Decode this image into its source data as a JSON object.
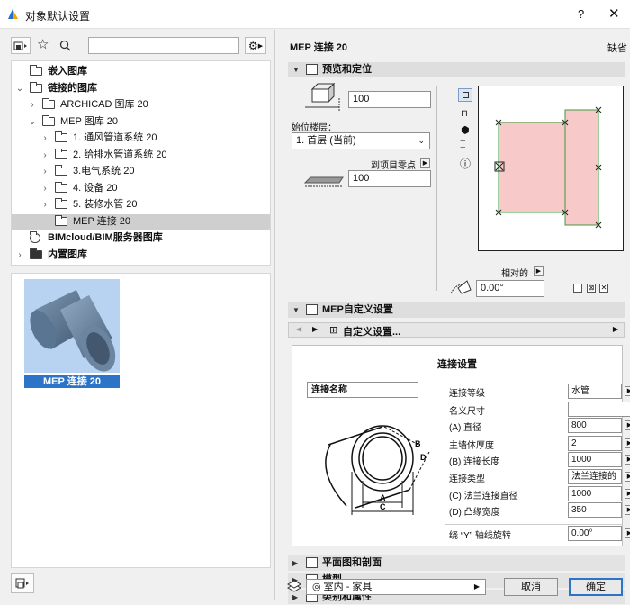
{
  "window": {
    "title": "对象默认设置",
    "help": "?",
    "close": "✕"
  },
  "left": {
    "search": {
      "value": "",
      "placeholder": ""
    },
    "tree": [
      {
        "label": "嵌入图库",
        "arrow": "",
        "bold": true,
        "icon": "library"
      },
      {
        "label": "链接的图库",
        "arrow": "v",
        "bold": true,
        "icon": "library"
      },
      {
        "label": "ARCHICAD 图库 20",
        "arrow": ">",
        "bold": false,
        "icon": "folder"
      },
      {
        "label": "MEP 图库 20",
        "arrow": "v",
        "bold": false,
        "icon": "folder"
      },
      {
        "label": "1. 通风管道系统 20",
        "arrow": ">",
        "bold": false,
        "icon": "folder"
      },
      {
        "label": "2. 给排水管道系统 20",
        "arrow": ">",
        "bold": false,
        "icon": "folder"
      },
      {
        "label": "3.电气系统 20",
        "arrow": ">",
        "bold": false,
        "icon": "folder"
      },
      {
        "label": "4. 设备 20",
        "arrow": ">",
        "bold": false,
        "icon": "folder"
      },
      {
        "label": "5. 装修水管 20",
        "arrow": ">",
        "bold": false,
        "icon": "folder"
      },
      {
        "label": "MEP 连接 20",
        "arrow": "",
        "bold": false,
        "icon": "folder"
      },
      {
        "label": "BIMcloud/BIM服务器图库",
        "arrow": "",
        "bold": true,
        "icon": "cloud"
      },
      {
        "label": "内置图库",
        "arrow": ">",
        "bold": true,
        "icon": "folder-dark"
      }
    ],
    "selected_object": "MEP 连接 20"
  },
  "right": {
    "object_name": "MEP 连接 20",
    "default_label": "缺省",
    "sections": {
      "preview": "预览和定位",
      "custom": "MEP自定义设置",
      "floorplan": "平面图和剖面",
      "model": "模型",
      "category": "类别和属性"
    },
    "height_value": "100",
    "home_story_label": "始位楼层：",
    "home_story_value": "1. 首层 (当前)",
    "to_project_zero": "到项目零点",
    "offset_value": "100",
    "relative_label": "相对的",
    "angle_value": "0.00°",
    "custom_settings_label": "自定义设置...",
    "connection_settings": {
      "title": "连接设置",
      "name_field": "连接名称",
      "rows": [
        {
          "label": "连接等级",
          "value": "水管"
        },
        {
          "label": "名义尺寸",
          "value": ""
        },
        {
          "label": "(A) 直径",
          "value": "800"
        },
        {
          "label": "主墙体厚度",
          "value": "2"
        },
        {
          "label": "(B) 连接长度",
          "value": "1000"
        },
        {
          "label": "连接类型",
          "value": "法兰连接的"
        },
        {
          "label": "(C) 法兰连接直径",
          "value": "1000"
        },
        {
          "label": "(D) 凸缘宽度",
          "value": "350"
        },
        {
          "label": "绕 “Y” 轴线旋转",
          "value": "0.00°"
        }
      ],
      "diagram_labels": {
        "a": "A",
        "b": "B",
        "c": "C",
        "d": "D"
      }
    },
    "layer_value": "◎ 室内 - 家具",
    "cancel": "取消",
    "ok": "确定"
  }
}
